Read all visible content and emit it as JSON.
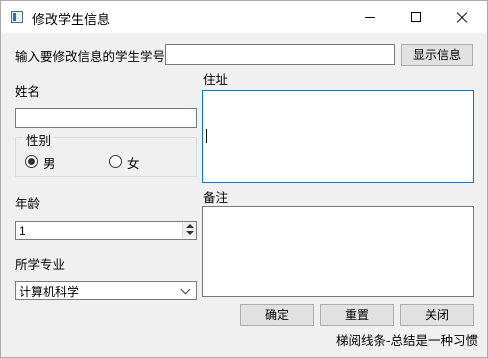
{
  "window": {
    "title": "修改学生信息",
    "icons": {
      "app": "app-icon",
      "minimize": "minimize-icon",
      "maximize": "maximize-icon",
      "close": "close-icon"
    }
  },
  "search": {
    "label": "输入要修改信息的学生学号",
    "value": "",
    "button": "显示信息"
  },
  "name": {
    "label": "姓名",
    "value": ""
  },
  "gender": {
    "title": "性别",
    "options": [
      {
        "label": "男",
        "checked": true
      },
      {
        "label": "女",
        "checked": false
      }
    ]
  },
  "age": {
    "label": "年龄",
    "value": "1"
  },
  "major": {
    "label": "所学专业",
    "selected": "计算机科学"
  },
  "address": {
    "label": "住址",
    "value": ""
  },
  "notes": {
    "label": "备注",
    "value": ""
  },
  "buttons": {
    "confirm": "确定",
    "reset": "重置",
    "close": "关闭"
  },
  "footer": {
    "text": "梯阅线条-总结是一种习惯"
  },
  "colors": {
    "focus_border": "#0078d7",
    "button_bg": "#e1e1e1",
    "window_bg": "#f0f0f0"
  }
}
